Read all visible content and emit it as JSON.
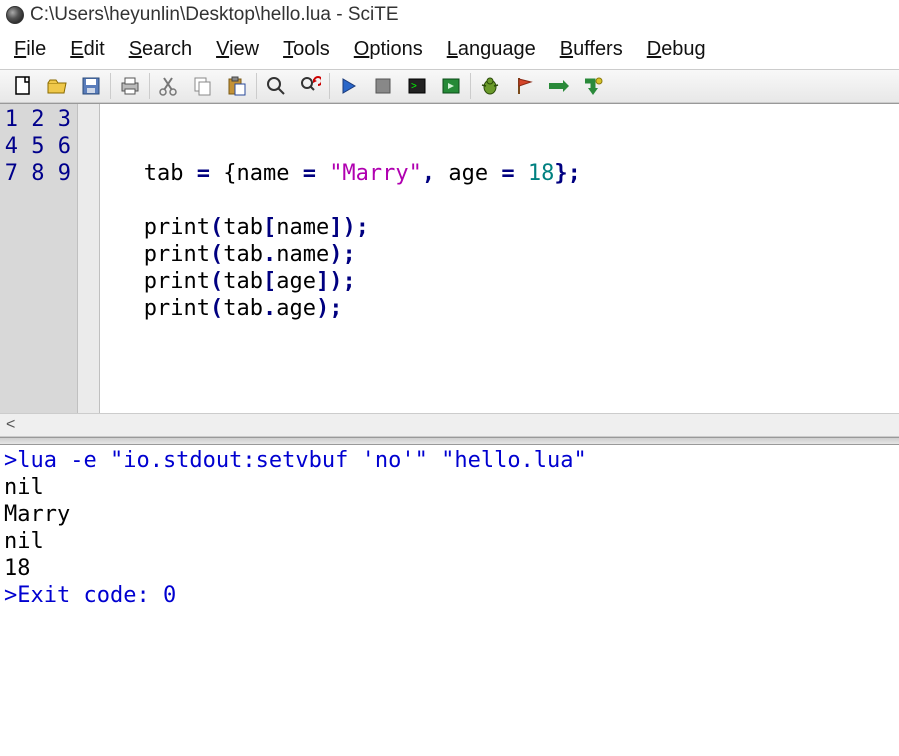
{
  "titlebar": {
    "title": "C:\\Users\\heyunlin\\Desktop\\hello.lua - SciTE"
  },
  "menus": [
    {
      "mn": "F",
      "rest": "ile"
    },
    {
      "mn": "E",
      "rest": "dit"
    },
    {
      "mn": "S",
      "rest": "earch"
    },
    {
      "mn": "V",
      "rest": "iew"
    },
    {
      "mn": "T",
      "rest": "ools"
    },
    {
      "mn": "O",
      "rest": "ptions"
    },
    {
      "mn": "L",
      "rest": "anguage"
    },
    {
      "mn": "B",
      "rest": "uffers"
    },
    {
      "mn": "D",
      "rest": "ebug"
    }
  ],
  "toolbar": {
    "new": "New",
    "open": "Open",
    "save": "Save",
    "print": "Print",
    "cut": "Cut",
    "copy": "Copy",
    "paste": "Paste",
    "find": "Find",
    "replace": "Replace",
    "go": "Go",
    "stop": "Stop",
    "console": "Console",
    "build": "Build",
    "bug": "Bug",
    "flag": "Flag",
    "stepover": "Step Over",
    "stepinto": "Step Into"
  },
  "line_numbers": [
    "1",
    "2",
    "3",
    "4",
    "5",
    "6",
    "7",
    "8",
    "9"
  ],
  "code_lines": [
    {
      "segs": []
    },
    {
      "segs": []
    },
    {
      "segs": [
        {
          "t": "   tab ",
          "c": "id"
        },
        {
          "t": "=",
          "c": "op"
        },
        {
          "t": " {name ",
          "c": "id"
        },
        {
          "t": "=",
          "c": "op"
        },
        {
          "t": " ",
          "c": "id"
        },
        {
          "t": "\"Marry\"",
          "c": "str"
        },
        {
          "t": ",",
          "c": "op"
        },
        {
          "t": " age ",
          "c": "id"
        },
        {
          "t": "=",
          "c": "op"
        },
        {
          "t": " ",
          "c": "id"
        },
        {
          "t": "18",
          "c": "num"
        },
        {
          "t": "};",
          "c": "op"
        }
      ]
    },
    {
      "segs": []
    },
    {
      "segs": [
        {
          "t": "   print",
          "c": "call"
        },
        {
          "t": "(",
          "c": "op"
        },
        {
          "t": "tab",
          "c": "id"
        },
        {
          "t": "[",
          "c": "op"
        },
        {
          "t": "name",
          "c": "id"
        },
        {
          "t": "]);",
          "c": "op"
        }
      ]
    },
    {
      "segs": [
        {
          "t": "   print",
          "c": "call"
        },
        {
          "t": "(",
          "c": "op"
        },
        {
          "t": "tab",
          "c": "id"
        },
        {
          "t": ".",
          "c": "op"
        },
        {
          "t": "name",
          "c": "id"
        },
        {
          "t": ");",
          "c": "op"
        }
      ]
    },
    {
      "segs": [
        {
          "t": "   print",
          "c": "call"
        },
        {
          "t": "(",
          "c": "op"
        },
        {
          "t": "tab",
          "c": "id"
        },
        {
          "t": "[",
          "c": "op"
        },
        {
          "t": "age",
          "c": "id"
        },
        {
          "t": "]);",
          "c": "op"
        }
      ]
    },
    {
      "segs": [
        {
          "t": "   print",
          "c": "call"
        },
        {
          "t": "(",
          "c": "op"
        },
        {
          "t": "tab",
          "c": "id"
        },
        {
          "t": ".",
          "c": "op"
        },
        {
          "t": "age",
          "c": "id"
        },
        {
          "t": ");",
          "c": "op"
        }
      ]
    },
    {
      "segs": []
    }
  ],
  "hscroll": {
    "left_arrow": "<"
  },
  "output_lines": [
    {
      "t": ">lua -e \"io.stdout:setvbuf 'no'\" \"hello.lua\"",
      "c": "cmd"
    },
    {
      "t": "nil",
      "c": ""
    },
    {
      "t": "Marry",
      "c": ""
    },
    {
      "t": "nil",
      "c": ""
    },
    {
      "t": "18",
      "c": ""
    },
    {
      "t": ">Exit code: 0",
      "c": "cmd"
    }
  ]
}
